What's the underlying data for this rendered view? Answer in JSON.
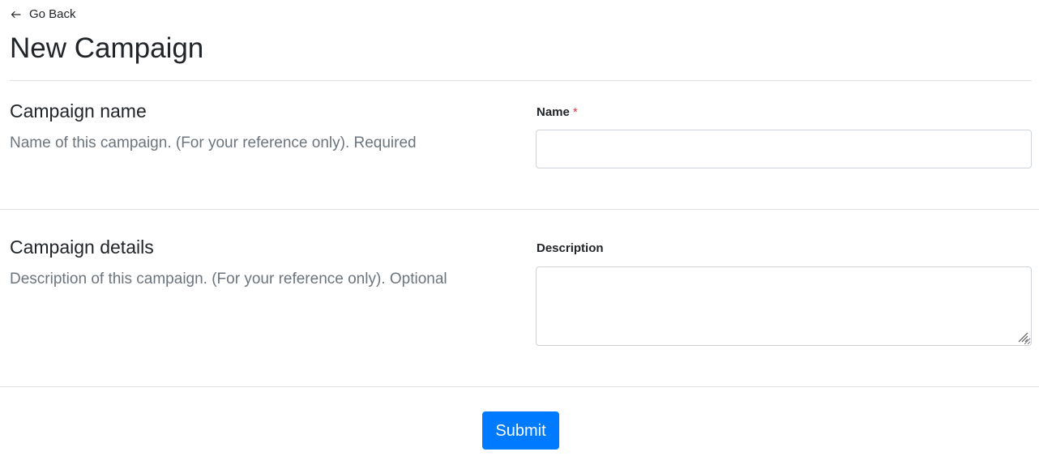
{
  "nav": {
    "back_icon": "arrow-left-icon",
    "back_label": "Go Back"
  },
  "page": {
    "title": "New Campaign"
  },
  "sections": {
    "name": {
      "title": "Campaign name",
      "description": "Name of this campaign. (For your reference only). Required",
      "field_label": "Name",
      "required_marker": "*",
      "value": "",
      "placeholder": ""
    },
    "details": {
      "title": "Campaign details",
      "description": "Description of this campaign. (For your reference only). Optional",
      "field_label": "Description",
      "value": "",
      "placeholder": ""
    }
  },
  "actions": {
    "submit_label": "Submit"
  },
  "colors": {
    "primary": "#007bff",
    "required": "#dc3545",
    "muted_text": "#6c757d",
    "border": "#ced4da",
    "divider": "#dee2e6"
  }
}
